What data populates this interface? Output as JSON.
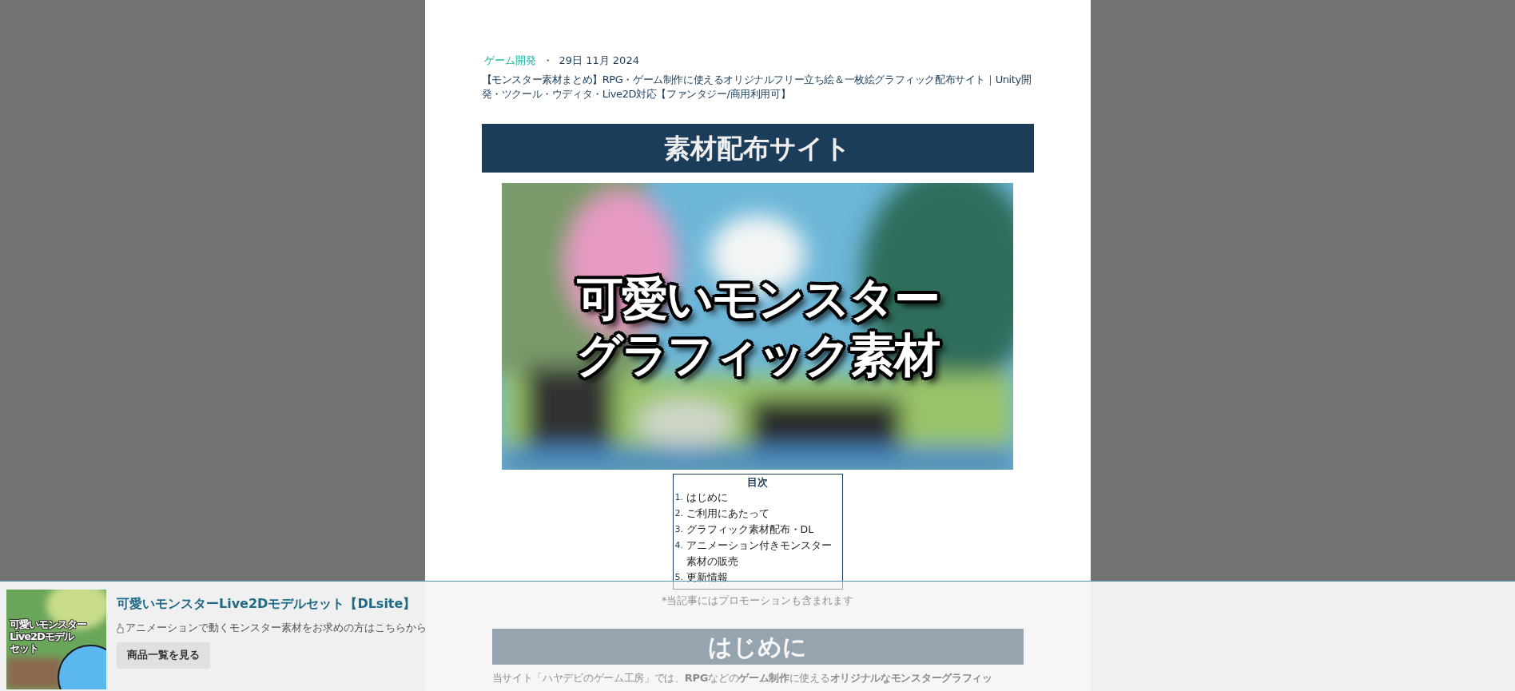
{
  "post_meta": {
    "category": "ゲーム開発",
    "separator": "・",
    "date": "29日 11月 2024"
  },
  "post_title": "【モンスター素材まとめ】RPG・ゲーム制作に使えるオリジナルフリー立ち絵＆一枚絵グラフィック配布サイト｜Unity開発・ツクール・ウディタ・Live2D対応【ファンタジー/商用利用可】",
  "section_heading": "素材配布サイト",
  "hero_image": {
    "kind": "picture",
    "caption_lines": [
      "可愛いモンスター",
      "グラフィック素材"
    ]
  },
  "toc": {
    "title": "目次",
    "items": [
      {
        "number": "1.",
        "label": "はじめに"
      },
      {
        "number": "2.",
        "label": "ご利用にあたって"
      },
      {
        "number": "3.",
        "label": "グラフィック素材配布・DL"
      },
      {
        "number": "4.",
        "label": "アニメーション付きモンスター素材の販売"
      },
      {
        "number": "5.",
        "label": "更新情報"
      }
    ]
  },
  "promo_note": "*当記事にはプロモーションも含まれます",
  "intro_heading": "はじめに",
  "intro_text": "当サイト「ハヤデビのゲーム工房」では、**RPG**などの**ゲーム制作**に使える**オリジナルなモンスターグラフィッ**",
  "promo_bar": {
    "thumbnail": {
      "kind": "picture",
      "caption_lines": [
        "可愛いモンスター",
        "Live2Dモデル",
        "セット"
      ]
    },
    "title": "可愛いモンスターLive2Dモデルセット【DLsite】",
    "description": "アニメーションで動くモンスター素材をお求めの方はこちらから",
    "button": "商品一覧を見る"
  }
}
